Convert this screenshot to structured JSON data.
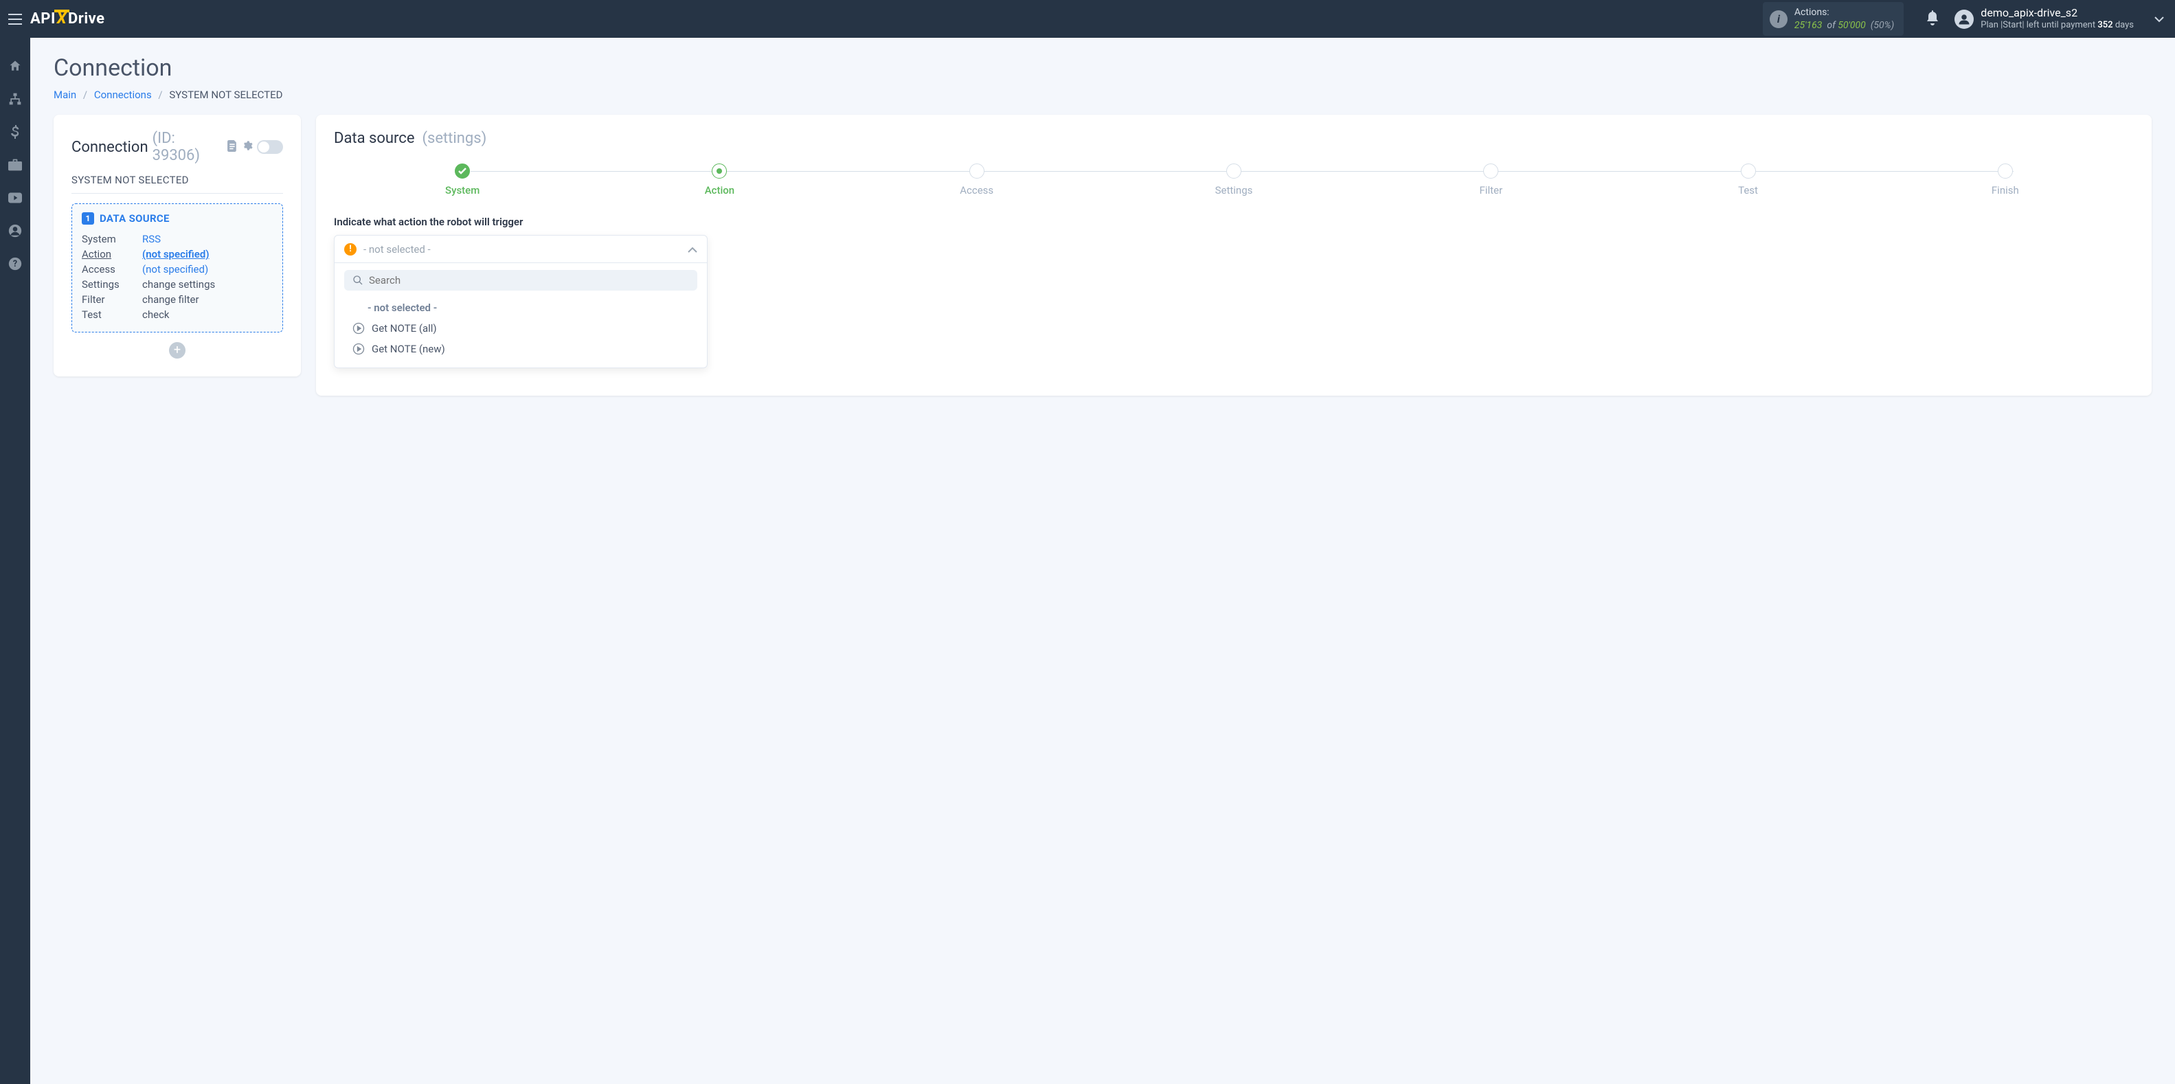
{
  "logo": {
    "part1": "API",
    "part2": "X",
    "part3": "Drive"
  },
  "actions_box": {
    "title": "Actions:",
    "used": "25'163",
    "of": "of",
    "limit": "50'000",
    "pct": "(50%)"
  },
  "user": {
    "name": "demo_apix-drive_s2",
    "plan_prefix": "Plan |Start| left until payment ",
    "days_num": "352",
    "days_suffix": " days"
  },
  "page": {
    "title": "Connection"
  },
  "crumbs": {
    "c1": "Main",
    "c2": "Connections",
    "c3": "SYSTEM NOT SELECTED"
  },
  "left": {
    "title": "Connection",
    "id_label": "(ID: 39306)",
    "not_selected": "SYSTEM NOT SELECTED",
    "ds_badge": "1",
    "ds_title": "DATA SOURCE",
    "rows": {
      "system_k": "System",
      "system_v": "RSS",
      "action_k": "Action",
      "action_v": "(not specified)",
      "access_k": "Access",
      "access_v": "(not specified)",
      "settings_k": "Settings",
      "settings_v": "change settings",
      "filter_k": "Filter",
      "filter_v": "change filter",
      "test_k": "Test",
      "test_v": "check"
    }
  },
  "right": {
    "title": "Data source",
    "subtitle": "(settings)",
    "instruction": "Indicate what action the robot will trigger",
    "steps": {
      "s1": "System",
      "s2": "Action",
      "s3": "Access",
      "s4": "Settings",
      "s5": "Filter",
      "s6": "Test",
      "s7": "Finish"
    },
    "dropdown": {
      "selected": "- not selected -",
      "search_placeholder": "Search",
      "opt_none": "- not selected -",
      "opt1": "Get NOTE (all)",
      "opt2": "Get NOTE (new)"
    }
  }
}
